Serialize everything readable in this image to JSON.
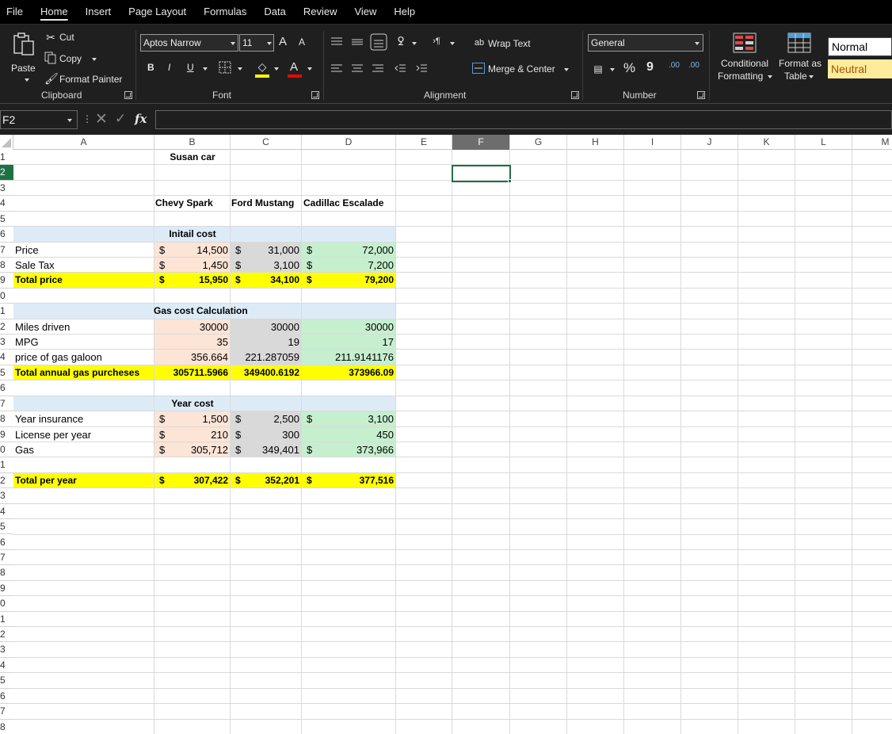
{
  "menu": [
    "File",
    "Home",
    "Insert",
    "Page Layout",
    "Formulas",
    "Data",
    "Review",
    "View",
    "Help"
  ],
  "ribbon": {
    "clipboard": {
      "paste": "Paste",
      "cut": "Cut",
      "copy": "Copy",
      "format_painter": "Format Painter",
      "label": "Clipboard"
    },
    "font": {
      "name": "Aptos Narrow",
      "size": "11",
      "grow": "A",
      "shrink": "A",
      "bold": "B",
      "italic": "I",
      "underline": "U",
      "label": "Font"
    },
    "alignment": {
      "wrap_text": "Wrap Text",
      "merge_center": "Merge & Center",
      "label": "Alignment"
    },
    "number": {
      "format": "General",
      "percent": "%",
      "comma": "9",
      "inc_decimal": ".00",
      "dec_decimal": ".00",
      "label": "Number"
    },
    "styles": {
      "conditional_1": "Conditional",
      "conditional_2": "Formatting",
      "format_as_1": "Format as",
      "format_as_2": "Table",
      "normal": "Normal",
      "neutral": "Neutral"
    }
  },
  "formula_bar": {
    "name_box": "F2",
    "fx": "fx",
    "value": ""
  },
  "columns": [
    "A",
    "B",
    "C",
    "D",
    "E",
    "F",
    "G",
    "H",
    "I",
    "J",
    "K",
    "L",
    "M"
  ],
  "rows": [
    "1",
    "2",
    "3",
    "4",
    "5",
    "6",
    "7",
    "8",
    "9",
    "0",
    "1",
    "2",
    "3",
    "4",
    "5",
    "6",
    "7",
    "8",
    "9",
    "0",
    "1",
    "2",
    "3",
    "4",
    "5",
    "6",
    "7",
    "8",
    "9",
    "0",
    "1",
    "2",
    "3",
    "4",
    "5",
    "6",
    "7",
    "8"
  ],
  "sheet": {
    "title": "Susan car",
    "cars": [
      "Chevy Spark",
      "Ford Mustang",
      "Cadillac Escalade"
    ],
    "initial_cost": {
      "header": "Initail cost",
      "price": {
        "label": "Price",
        "cur": [
          "$",
          "$",
          "$"
        ],
        "values": [
          "14,500",
          "31,000",
          "72,000"
        ]
      },
      "tax": {
        "label": "Sale Tax",
        "cur": [
          "$",
          "$",
          "$"
        ],
        "values": [
          "1,450",
          "3,100",
          "7,200"
        ]
      },
      "total": {
        "label": "Total price",
        "cur": [
          "$",
          "$",
          "$"
        ],
        "values": [
          "15,950",
          "34,100",
          "79,200"
        ]
      }
    },
    "gas": {
      "header": "Gas cost Calculation",
      "miles": {
        "label": "Miles driven",
        "values": [
          "30000",
          "30000",
          "30000"
        ]
      },
      "mpg": {
        "label": "MPG",
        "values": [
          "35",
          "19",
          "17"
        ]
      },
      "price": {
        "label": "price of gas galoon",
        "values": [
          "356.664",
          "221.287059",
          "211.9141176"
        ]
      },
      "total": {
        "label": "Total annual gas purcheses",
        "values": [
          "305711.5966",
          "349400.6192",
          "373966.09"
        ]
      }
    },
    "year_cost": {
      "header": "Year cost",
      "insurance": {
        "label": "Year insurance",
        "cur": [
          "$",
          "$",
          "$"
        ],
        "values": [
          "1,500",
          "2,500",
          "3,100"
        ]
      },
      "license": {
        "label": "License per year",
        "cur": [
          "$",
          "$"
        ],
        "values": [
          "210",
          "300",
          "450"
        ]
      },
      "gas": {
        "label": "Gas",
        "cur": [
          "$",
          "$",
          "$"
        ],
        "values": [
          "305,712",
          "349,401",
          "373,966"
        ]
      }
    },
    "total_year": {
      "label": "Total per year",
      "cur": [
        "$",
        "$",
        "$"
      ],
      "values": [
        "307,422",
        "352,201",
        "377,516"
      ]
    }
  },
  "colors": {
    "ribbon_bg": "#1f1f1f",
    "accent_green": "#1e7145",
    "header_blue": "#ddebf7",
    "pink": "#fce4d6",
    "gray": "#d9d9d9",
    "green": "#c6efce",
    "yellow": "#ffff00"
  }
}
